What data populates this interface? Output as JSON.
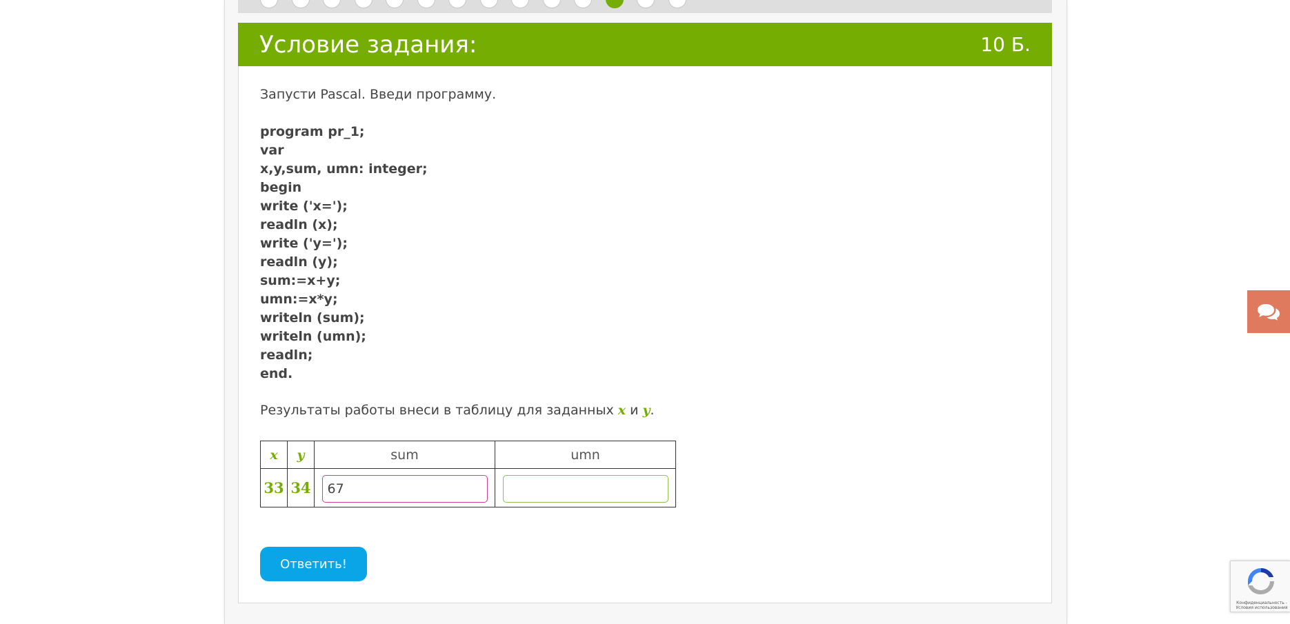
{
  "progress": {
    "total_steps": 14,
    "active_index": 11
  },
  "task": {
    "title": "Условие задания:",
    "points": "10 Б.",
    "intro": "Запусти Pascal. Введи программу.",
    "code_lines": [
      "program pr_1;",
      "var",
      "x,y,sum, umn: integer;",
      "begin",
      "write ('x=');",
      "readln (x);",
      "write ('y=');",
      "readln (y);",
      "sum:=x+y;",
      "umn:=x*y;",
      "writeln (sum);",
      "writeln (umn);",
      "readln;",
      "end."
    ],
    "results_prefix": "Результаты работы внеси в таблицу для заданных ",
    "var_x": "x",
    "results_and": " и ",
    "var_y": "y",
    "results_suffix": "."
  },
  "table": {
    "headers": {
      "x": "x",
      "y": "y",
      "sum": "sum",
      "umn": "umn"
    },
    "row": {
      "x": "33",
      "y": "34",
      "sum_value": "67",
      "umn_value": ""
    }
  },
  "submit_label": "Ответить!",
  "recaptcha": {
    "privacy": "Конфиденциальность -",
    "terms": "Условия использования"
  },
  "colors": {
    "accent_green": "#76ad03",
    "button_blue": "#0aa5e6",
    "chat_orange": "#e07a5f",
    "input_filled_border": "#cc3f9b",
    "input_empty_border": "#8cc152"
  },
  "icons": {
    "chat": "chat-bubbles-icon",
    "recaptcha": "recaptcha-logo-icon"
  }
}
